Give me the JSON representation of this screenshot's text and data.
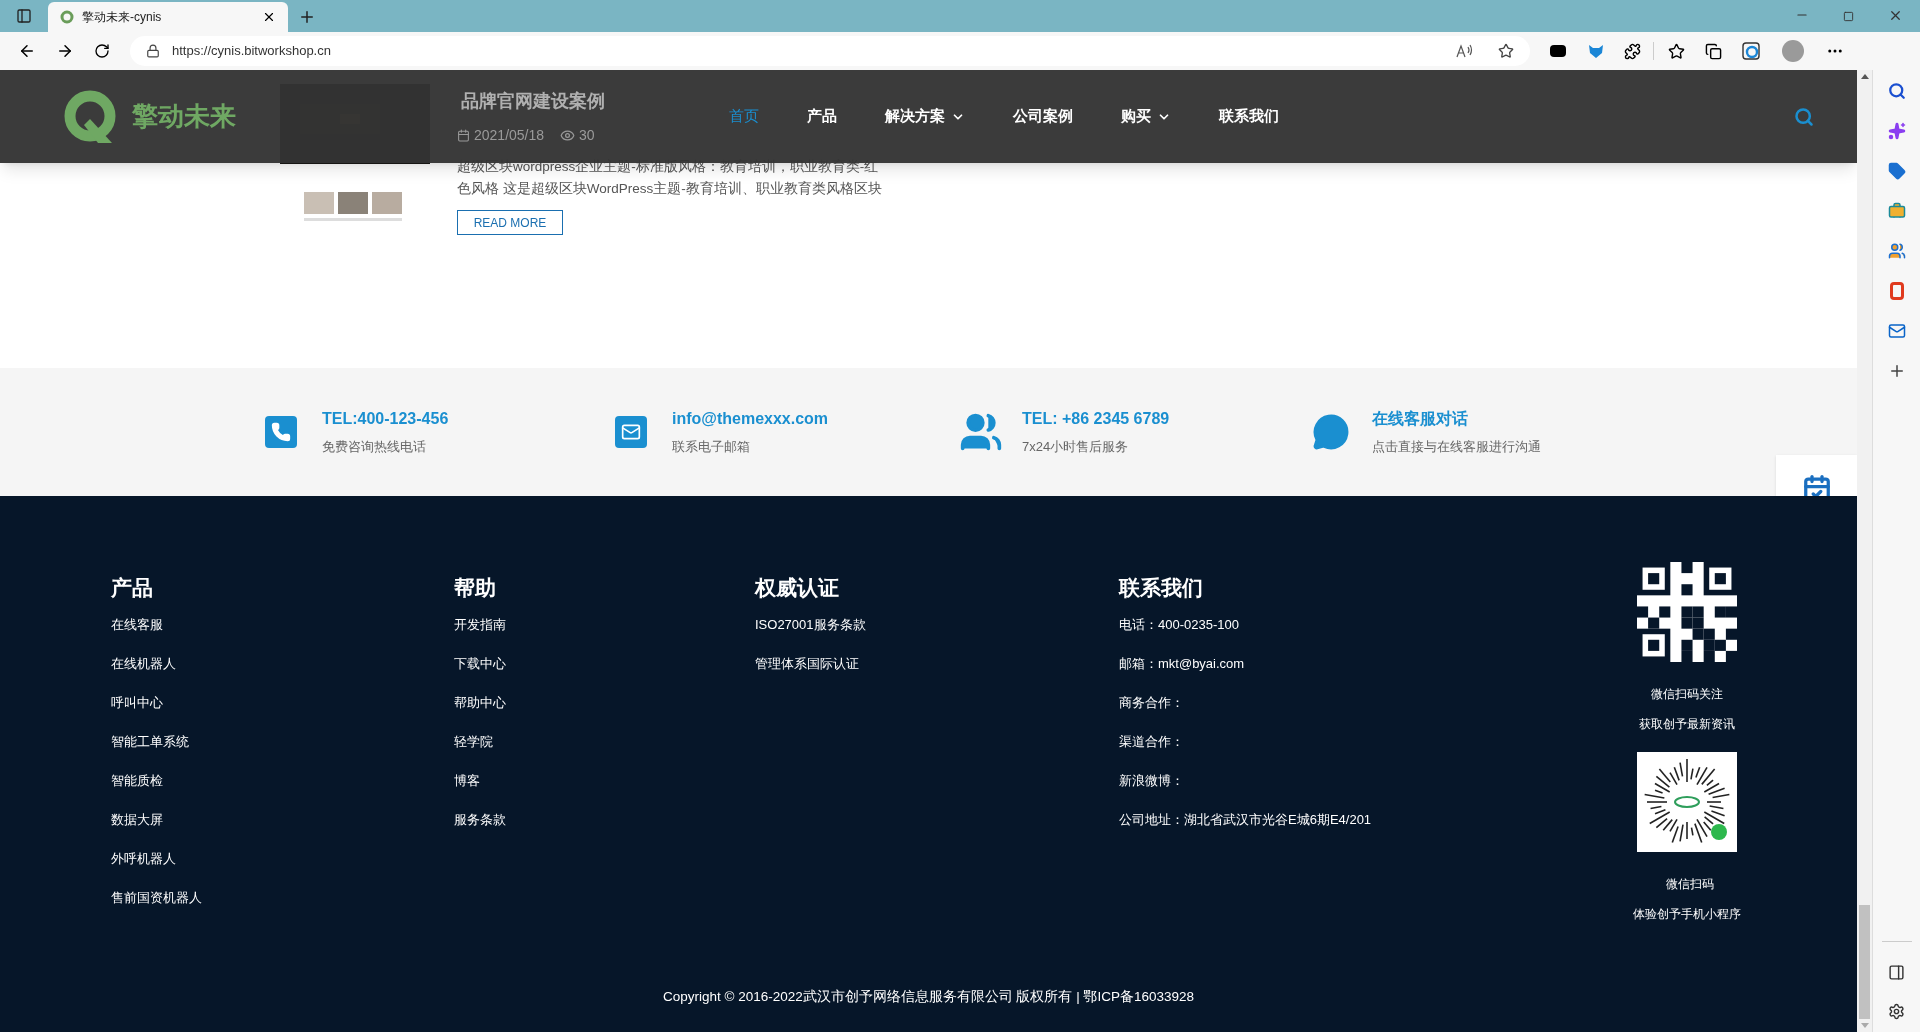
{
  "browser": {
    "tab_title": "擎动未来-cynis",
    "address": "https://cynis.bitworkshop.cn"
  },
  "site": {
    "logo_text": "擎动未来",
    "nav": [
      {
        "label": "首页",
        "selected": true,
        "dropdown": false
      },
      {
        "label": "产品",
        "selected": false,
        "dropdown": false
      },
      {
        "label": "解决方案",
        "selected": false,
        "dropdown": true
      },
      {
        "label": "公司案例",
        "selected": false,
        "dropdown": false
      },
      {
        "label": "购买",
        "selected": false,
        "dropdown": true
      },
      {
        "label": "联系我们",
        "selected": false,
        "dropdown": false
      }
    ]
  },
  "post": {
    "title": "品牌官网建设案例",
    "date": "2021/05/18",
    "views": "30",
    "excerpt": "超级区块wordpress企业主题-标准版风格：教育培训，职业教育类-红色风格 这是超级区块WordPress主题-教育培训、职业教育类风格区块",
    "button": "READ MORE"
  },
  "contacts": [
    {
      "kind": "phone",
      "title": "TEL:400-123-456",
      "subtitle": "免费咨询热线电话"
    },
    {
      "kind": "mail",
      "title": "info@themexxx.com",
      "subtitle": "联系电子邮箱"
    },
    {
      "kind": "people",
      "title": "TEL: +86 2345 6789",
      "subtitle": "7x24小时售后服务"
    },
    {
      "kind": "chat",
      "title": "在线客服对话",
      "subtitle": "点击直接与在线客服进行沟通"
    }
  ],
  "footer": {
    "columns": [
      {
        "heading": "产品",
        "items": [
          "在线客服",
          "在线机器人",
          "呼叫中心",
          "智能工单系统",
          "智能质检",
          "数据大屏",
          "外呼机器人",
          "售前国资机器人"
        ]
      },
      {
        "heading": "帮助",
        "items": [
          "开发指南",
          "下载中心",
          "帮助中心",
          "轻学院",
          "博客",
          "服务条款"
        ]
      },
      {
        "heading": "权威认证",
        "items": [
          "ISO27001服务条款",
          "管理体系国际认证"
        ]
      },
      {
        "heading": "联系我们",
        "items": [
          "电话：400-0235-100",
          "邮箱：mkt@byai.com",
          "商务合作：",
          "渠道合作：",
          "新浪微博：",
          "公司地址：湖北省武汉市光谷E城6期E4/201"
        ]
      }
    ],
    "codes": [
      {
        "kind": "qr",
        "captions": [
          "微信扫码关注",
          "获取创予最新资讯"
        ]
      },
      {
        "kind": "miniprogram",
        "captions": [
          "微信扫码",
          "体验创予手机小程序"
        ]
      }
    ],
    "copyright": "Copyright © 2016-2022武汉市创予网络信息服务有限公司 版权所有 | 鄂ICP备16033928"
  }
}
